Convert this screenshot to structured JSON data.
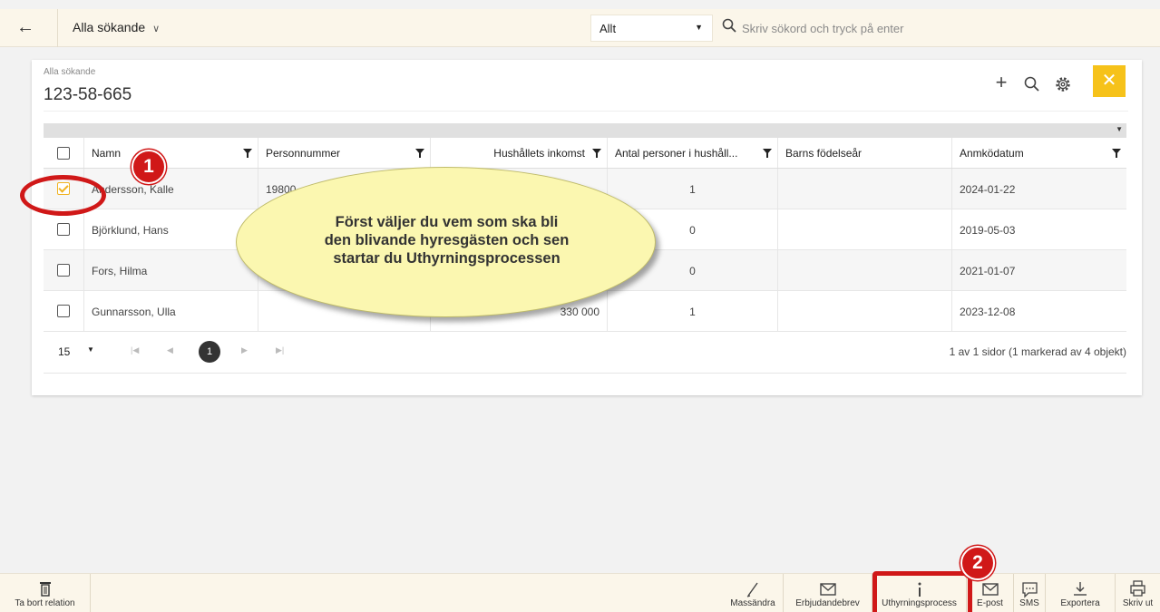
{
  "topbar": {
    "view_label": "Alla sökande",
    "scope_value": "Allt",
    "search_placeholder": "Skriv sökord och tryck på enter"
  },
  "card": {
    "breadcrumb": "Alla sökande",
    "title": "123-58-665"
  },
  "grid": {
    "columns": [
      "Namn",
      "Personnummer",
      "Hushållets inkomst",
      "Antal personer i hushåll...",
      "Barns födelseår",
      "Anmködatum"
    ],
    "rows": [
      {
        "name": "Andersson, Kalle",
        "pnr": "19800",
        "income": "",
        "persons": "1",
        "child_years": "",
        "date": "2024-01-22",
        "checked": true
      },
      {
        "name": "Björklund, Hans",
        "pnr": "",
        "income": "",
        "persons": "0",
        "child_years": "",
        "date": "2019-05-03",
        "checked": false
      },
      {
        "name": "Fors, Hilma",
        "pnr": "",
        "income": "",
        "persons": "0",
        "child_years": "",
        "date": "2021-01-07",
        "checked": false
      },
      {
        "name": "Gunnarsson, Ulla",
        "pnr": "",
        "income": "330 000",
        "persons": "1",
        "child_years": "",
        "date": "2023-12-08",
        "checked": false
      }
    ]
  },
  "pager": {
    "page_size": "15",
    "current_page": "1",
    "info": "1 av 1 sidor (1 markerad av 4 objekt)"
  },
  "annotation": {
    "callout": "Först väljer du vem som ska bli\nden blivande hyresgästen och sen\nstartar du Uthyrningsprocessen",
    "marker1": "1",
    "marker2": "2"
  },
  "bottombar": {
    "delete_label": "Ta bort relation",
    "actions": [
      "Massändra",
      "Erbjudandebrev",
      "Uthyrningsprocess",
      "E-post",
      "SMS",
      "Exportera",
      "Skriv ut"
    ]
  },
  "colors": {
    "accent": "#f6c21a",
    "annotation_red": "#d01818",
    "callout_fill": "#fbf7b0",
    "bar_bg": "#fbf6ea"
  }
}
